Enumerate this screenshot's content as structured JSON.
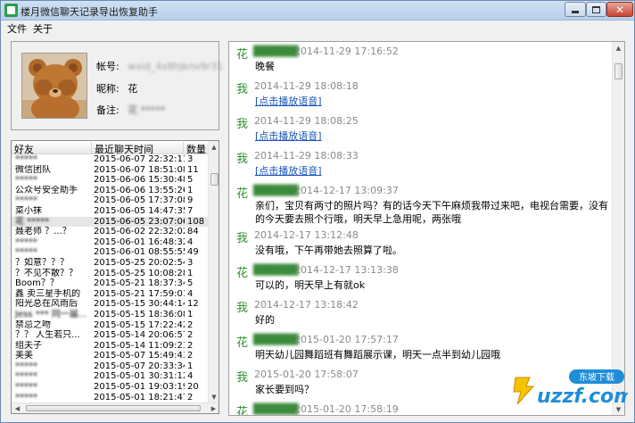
{
  "window": {
    "title": "楼月微信聊天记录导出恢复助手",
    "close_glyph": "✕"
  },
  "menu": [
    "文件",
    "关于"
  ],
  "profile": {
    "account_label": "帐号:",
    "account_value": "wxid_4x8hjknv9r31",
    "nickname_label": "昵称:",
    "nickname_value": "花",
    "remark_label": "备注:",
    "remark_value": "花 *****"
  },
  "friend_list": {
    "headers": [
      "好友",
      "最近聊天时间",
      "数量"
    ],
    "rows": [
      {
        "name": "*****",
        "time": "2015-06-07 22:32:11",
        "count": "3"
      },
      {
        "name": "微信团队",
        "time": "2015-06-07 18:51:08",
        "count": "11"
      },
      {
        "name": "*****",
        "time": "2015-06-06 15:30:48",
        "count": "5"
      },
      {
        "name": "公众号安全助手",
        "time": "2015-06-06 13:55:26",
        "count": "1"
      },
      {
        "name": "*****",
        "time": "2015-06-05 17:37:08",
        "count": "9"
      },
      {
        "name": "菜小抹",
        "time": "2015-06-05 14:47:35",
        "count": "7"
      },
      {
        "name": "花 *****",
        "time": "2015-06-05 23:07:06",
        "count": "108"
      },
      {
        "name": "聂老师 ？...？",
        "time": "2015-06-02 22:32:02",
        "count": "84"
      },
      {
        "name": "*****",
        "time": "2015-06-01 16:48:32",
        "count": "4"
      },
      {
        "name": "*****",
        "time": "2015-06-01 08:55:55",
        "count": "49"
      },
      {
        "name": "？如意？？？",
        "time": "2015-05-25 20:02:54",
        "count": "3"
      },
      {
        "name": "？不见不散？？",
        "time": "2015-05-25 10:08:28",
        "count": "1"
      },
      {
        "name": "Boom？？",
        "time": "2015-05-21 18:37:34",
        "count": "5"
      },
      {
        "name": "鑫 卖三星手机的",
        "time": "2015-05-21 17:59:01",
        "count": "4"
      },
      {
        "name": "阳光总在风雨后",
        "time": "2015-05-15 30:44:14",
        "count": "12"
      },
      {
        "name": "Jess *** 同一届...",
        "time": "2015-05-15 18:36:08",
        "count": "1"
      },
      {
        "name": "禁忌之吻",
        "time": "2015-05-15 17:22:42",
        "count": "2"
      },
      {
        "name": "？？  人生若只...",
        "time": "2015-05-14 20:06:57",
        "count": "2"
      },
      {
        "name": "组夫子",
        "time": "2015-05-14 11:09:23",
        "count": "2"
      },
      {
        "name": "美美",
        "time": "2015-05-07 15:49:43",
        "count": "2"
      },
      {
        "name": "*****",
        "time": "2015-05-07 20:33:34",
        "count": "1"
      },
      {
        "name": "*****",
        "time": "2015-05-01 30:31:12",
        "count": "4"
      },
      {
        "name": "*****",
        "time": "2015-05-01 19:03:19",
        "count": "20"
      },
      {
        "name": "*****",
        "time": "2015-05-01 18:21:47",
        "count": "2"
      }
    ]
  },
  "chat": {
    "messages": [
      {
        "sender": "花",
        "masked": true,
        "time": "2014-11-29 17:16:52",
        "text": "晚餐",
        "voice": false
      },
      {
        "sender": "我",
        "masked": false,
        "time": "2014-11-29 18:08:18",
        "text": "[点击播放语音]",
        "voice": true
      },
      {
        "sender": "我",
        "masked": false,
        "time": "2014-11-29 18:08:25",
        "text": "[点击播放语音]",
        "voice": true
      },
      {
        "sender": "我",
        "masked": false,
        "time": "2014-11-29 18:08:33",
        "text": "[点击播放语音]",
        "voice": true
      },
      {
        "sender": "花",
        "masked": true,
        "time": "2014-12-17 13:09:37",
        "text": "亲们，宝贝有两寸的照片吗？有的话今天下午麻烦我带过来吧，电视台需要，没有的今天要去照个行哦，明天早上急用呢，两张哦",
        "voice": false
      },
      {
        "sender": "我",
        "masked": false,
        "time": "2014-12-17 13:12:48",
        "text": "没有哦，下午再带她去照算了啦。",
        "voice": false
      },
      {
        "sender": "花",
        "masked": true,
        "time": "2014-12-17 13:13:38",
        "text": "可以的，明天早上有就ok",
        "voice": false
      },
      {
        "sender": "我",
        "masked": false,
        "time": "2014-12-17 13:18:42",
        "text": "好的",
        "voice": false
      },
      {
        "sender": "花",
        "masked": true,
        "time": "2015-01-20 17:57:17",
        "text": "明天幼儿园舞蹈班有舞蹈展示课，明天一点半到幼儿园哦",
        "voice": false
      },
      {
        "sender": "我",
        "masked": false,
        "time": "2015-01-20 17:58:07",
        "text": "家长要到吗？",
        "voice": false
      },
      {
        "sender": "花",
        "masked": true,
        "time": "2015-01-20 17:58:19",
        "text": "",
        "voice": false
      }
    ]
  },
  "watermark": {
    "badge_text": "东坡下载",
    "domain": "uzzf.com"
  },
  "colors": {
    "sender": "#2f8f2f",
    "timestamp": "#8a8a8a",
    "voice_link": "#1a55b8",
    "title_gradient": "#cfe0f3"
  }
}
